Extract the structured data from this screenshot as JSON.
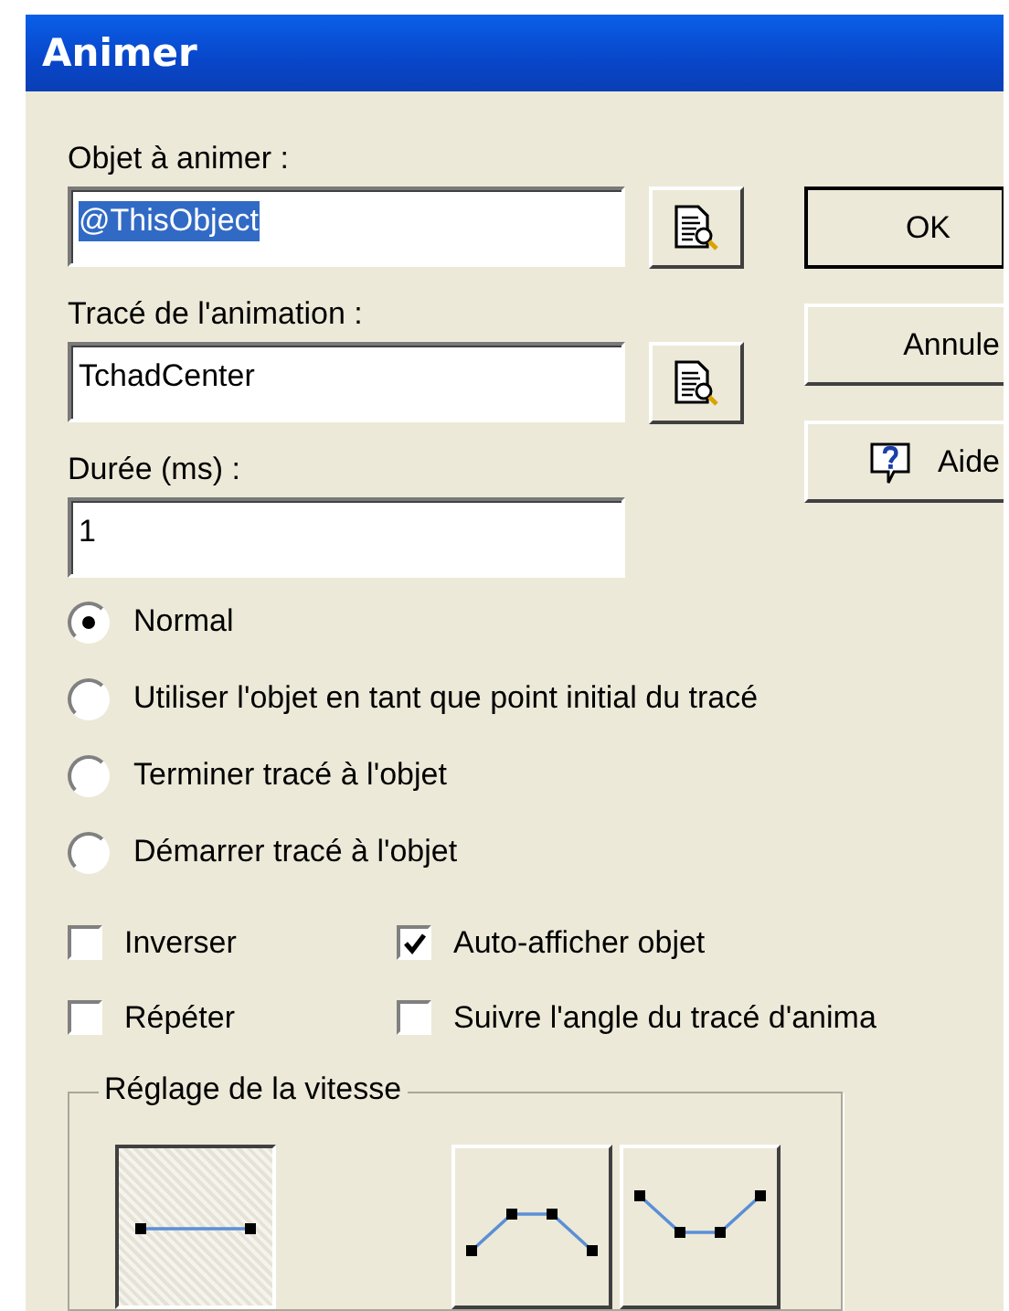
{
  "window": {
    "title": "Animer"
  },
  "fields": [
    {
      "label": "Objet à animer :",
      "value": "@ThisObject",
      "text_selected": true,
      "browse": true
    },
    {
      "label": "Tracé de l'animation :",
      "value": "TchadCenter",
      "text_selected": false,
      "browse": true
    },
    {
      "label": "Durée (ms) :",
      "value": "1",
      "text_selected": false,
      "browse": false
    }
  ],
  "buttons": [
    {
      "label": "OK",
      "kind": "default"
    },
    {
      "label": "Annule",
      "kind": "plain"
    },
    {
      "label": "Aide",
      "kind": "help"
    }
  ],
  "radios": [
    {
      "label": "Normal",
      "selected": true
    },
    {
      "label": "Utiliser l'objet en tant que point initial du tracé",
      "selected": false
    },
    {
      "label": "Terminer tracé à l'objet",
      "selected": false
    },
    {
      "label": "Démarrer tracé à l'objet",
      "selected": false
    }
  ],
  "checkboxes": [
    {
      "label": "Inverser",
      "checked": false
    },
    {
      "label": "Auto-afficher objet",
      "checked": true
    },
    {
      "label": "Répéter",
      "checked": false
    },
    {
      "label": "Suivre l'angle du tracé d'anima",
      "checked": false
    }
  ],
  "speed_group": {
    "title": "Réglage de la vitesse",
    "presets": [
      {
        "selected": true
      },
      {
        "selected": false
      },
      {
        "selected": false
      }
    ]
  }
}
